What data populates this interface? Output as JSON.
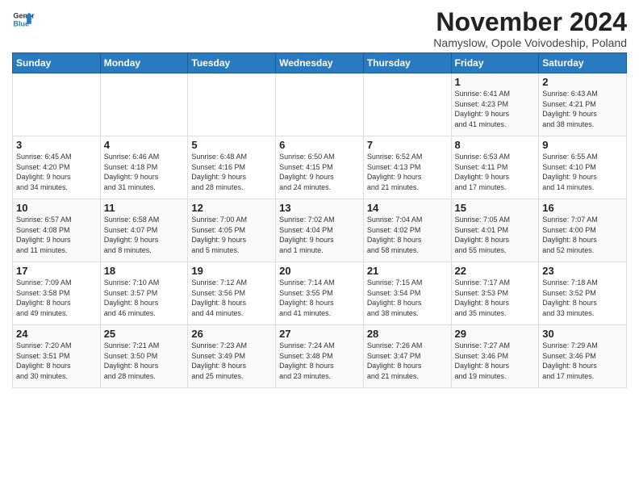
{
  "logo": {
    "text_general": "General",
    "text_blue": "Blue"
  },
  "title": "November 2024",
  "subtitle": "Namyslow, Opole Voivodeship, Poland",
  "headers": [
    "Sunday",
    "Monday",
    "Tuesday",
    "Wednesday",
    "Thursday",
    "Friday",
    "Saturday"
  ],
  "weeks": [
    [
      {
        "day": "",
        "info": ""
      },
      {
        "day": "",
        "info": ""
      },
      {
        "day": "",
        "info": ""
      },
      {
        "day": "",
        "info": ""
      },
      {
        "day": "",
        "info": ""
      },
      {
        "day": "1",
        "info": "Sunrise: 6:41 AM\nSunset: 4:23 PM\nDaylight: 9 hours\nand 41 minutes."
      },
      {
        "day": "2",
        "info": "Sunrise: 6:43 AM\nSunset: 4:21 PM\nDaylight: 9 hours\nand 38 minutes."
      }
    ],
    [
      {
        "day": "3",
        "info": "Sunrise: 6:45 AM\nSunset: 4:20 PM\nDaylight: 9 hours\nand 34 minutes."
      },
      {
        "day": "4",
        "info": "Sunrise: 6:46 AM\nSunset: 4:18 PM\nDaylight: 9 hours\nand 31 minutes."
      },
      {
        "day": "5",
        "info": "Sunrise: 6:48 AM\nSunset: 4:16 PM\nDaylight: 9 hours\nand 28 minutes."
      },
      {
        "day": "6",
        "info": "Sunrise: 6:50 AM\nSunset: 4:15 PM\nDaylight: 9 hours\nand 24 minutes."
      },
      {
        "day": "7",
        "info": "Sunrise: 6:52 AM\nSunset: 4:13 PM\nDaylight: 9 hours\nand 21 minutes."
      },
      {
        "day": "8",
        "info": "Sunrise: 6:53 AM\nSunset: 4:11 PM\nDaylight: 9 hours\nand 17 minutes."
      },
      {
        "day": "9",
        "info": "Sunrise: 6:55 AM\nSunset: 4:10 PM\nDaylight: 9 hours\nand 14 minutes."
      }
    ],
    [
      {
        "day": "10",
        "info": "Sunrise: 6:57 AM\nSunset: 4:08 PM\nDaylight: 9 hours\nand 11 minutes."
      },
      {
        "day": "11",
        "info": "Sunrise: 6:58 AM\nSunset: 4:07 PM\nDaylight: 9 hours\nand 8 minutes."
      },
      {
        "day": "12",
        "info": "Sunrise: 7:00 AM\nSunset: 4:05 PM\nDaylight: 9 hours\nand 5 minutes."
      },
      {
        "day": "13",
        "info": "Sunrise: 7:02 AM\nSunset: 4:04 PM\nDaylight: 9 hours\nand 1 minute."
      },
      {
        "day": "14",
        "info": "Sunrise: 7:04 AM\nSunset: 4:02 PM\nDaylight: 8 hours\nand 58 minutes."
      },
      {
        "day": "15",
        "info": "Sunrise: 7:05 AM\nSunset: 4:01 PM\nDaylight: 8 hours\nand 55 minutes."
      },
      {
        "day": "16",
        "info": "Sunrise: 7:07 AM\nSunset: 4:00 PM\nDaylight: 8 hours\nand 52 minutes."
      }
    ],
    [
      {
        "day": "17",
        "info": "Sunrise: 7:09 AM\nSunset: 3:58 PM\nDaylight: 8 hours\nand 49 minutes."
      },
      {
        "day": "18",
        "info": "Sunrise: 7:10 AM\nSunset: 3:57 PM\nDaylight: 8 hours\nand 46 minutes."
      },
      {
        "day": "19",
        "info": "Sunrise: 7:12 AM\nSunset: 3:56 PM\nDaylight: 8 hours\nand 44 minutes."
      },
      {
        "day": "20",
        "info": "Sunrise: 7:14 AM\nSunset: 3:55 PM\nDaylight: 8 hours\nand 41 minutes."
      },
      {
        "day": "21",
        "info": "Sunrise: 7:15 AM\nSunset: 3:54 PM\nDaylight: 8 hours\nand 38 minutes."
      },
      {
        "day": "22",
        "info": "Sunrise: 7:17 AM\nSunset: 3:53 PM\nDaylight: 8 hours\nand 35 minutes."
      },
      {
        "day": "23",
        "info": "Sunrise: 7:18 AM\nSunset: 3:52 PM\nDaylight: 8 hours\nand 33 minutes."
      }
    ],
    [
      {
        "day": "24",
        "info": "Sunrise: 7:20 AM\nSunset: 3:51 PM\nDaylight: 8 hours\nand 30 minutes."
      },
      {
        "day": "25",
        "info": "Sunrise: 7:21 AM\nSunset: 3:50 PM\nDaylight: 8 hours\nand 28 minutes."
      },
      {
        "day": "26",
        "info": "Sunrise: 7:23 AM\nSunset: 3:49 PM\nDaylight: 8 hours\nand 25 minutes."
      },
      {
        "day": "27",
        "info": "Sunrise: 7:24 AM\nSunset: 3:48 PM\nDaylight: 8 hours\nand 23 minutes."
      },
      {
        "day": "28",
        "info": "Sunrise: 7:26 AM\nSunset: 3:47 PM\nDaylight: 8 hours\nand 21 minutes."
      },
      {
        "day": "29",
        "info": "Sunrise: 7:27 AM\nSunset: 3:46 PM\nDaylight: 8 hours\nand 19 minutes."
      },
      {
        "day": "30",
        "info": "Sunrise: 7:29 AM\nSunset: 3:46 PM\nDaylight: 8 hours\nand 17 minutes."
      }
    ]
  ]
}
